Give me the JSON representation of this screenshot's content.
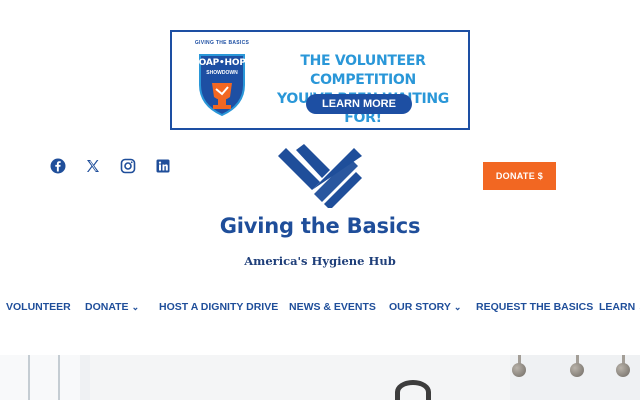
{
  "banner": {
    "badge_top": "GIVING THE BASICS",
    "badge_title": "SOAP•HOPE",
    "badge_sub": "SHOWDOWN",
    "headline_line1": "THE VOLUNTEER COMPETITION",
    "headline_line2": "YOU'VE BEEN WAITING FOR!",
    "cta_label": "LEARN MORE"
  },
  "social": {
    "icons": [
      "facebook-icon",
      "x-twitter-icon",
      "instagram-icon",
      "linkedin-icon"
    ]
  },
  "brand": {
    "name": "Giving the Basics",
    "tagline": "America's Hygiene Hub"
  },
  "donate_button": {
    "label": "DONATE $"
  },
  "nav": {
    "items": [
      {
        "label": "VOLUNTEER",
        "dropdown": false
      },
      {
        "label": "DONATE",
        "dropdown": true
      },
      {
        "label": "HOST A DIGNITY DRIVE",
        "dropdown": false
      },
      {
        "label": "NEWS & EVENTS",
        "dropdown": false
      },
      {
        "label": "OUR STORY",
        "dropdown": true
      },
      {
        "label": "REQUEST THE BASICS",
        "dropdown": false
      },
      {
        "label": "LEARN",
        "dropdown": true
      }
    ],
    "chevron": "⌄"
  },
  "colors": {
    "brand_blue": "#1f4e9a",
    "accent_orange": "#f26722",
    "headline_cyan": "#2a97d8"
  }
}
